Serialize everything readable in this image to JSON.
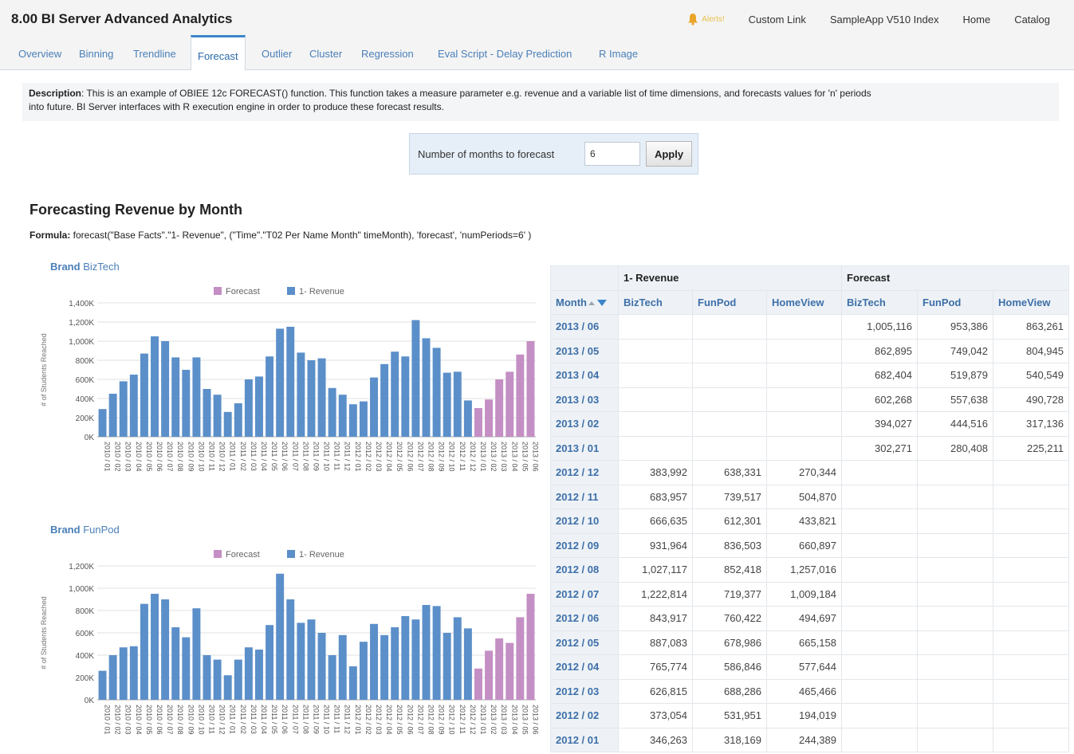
{
  "header": {
    "app_title": "8.00 BI Server Advanced Analytics",
    "alerts_label": "Alerts!",
    "links": [
      "Custom Link",
      "SampleApp V510 Index",
      "Home",
      "Catalog"
    ]
  },
  "tabs": [
    "Overview",
    "Binning",
    "Trendline",
    "Forecast",
    "Outlier",
    "Cluster",
    "Regression",
    "Eval Script - Delay Prediction",
    "R Image"
  ],
  "active_tab": "Forecast",
  "description": {
    "label": "Description",
    "text": ": This is an example of OBIEE 12c FORECAST() function. This function takes a measure parameter e.g. revenue and a variable list of time dimensions, and forecasts values for 'n' periods",
    "text_line2": "into future. BI Server interfaces with R execution engine in order to produce these forecast results."
  },
  "prompt": {
    "label": "Number of months to forecast",
    "value": "6",
    "apply_label": "Apply"
  },
  "section": {
    "title": "Forecasting Revenue by Month",
    "formula_label": "Formula:",
    "formula_text": " forecast(\"Base Facts\".\"1- Revenue\", (\"Time\".\"T02 Per Name Month\" timeMonth), 'forecast', 'numPeriods=6' )"
  },
  "colors": {
    "revenue": "#5b8fc9",
    "forecast": "#c48fc4",
    "accent": "#3c86c9"
  },
  "chart_data": [
    {
      "type": "bar",
      "brand_prefix": "Brand",
      "brand": "BizTech",
      "ylabel": "# of Students Reached",
      "legend": [
        "Forecast",
        "1- Revenue"
      ],
      "legend_position": "top",
      "ylim": [
        0,
        1400000
      ],
      "yticks": [
        "0K",
        "200K",
        "400K",
        "600K",
        "800K",
        "1,000K",
        "1,200K",
        "1,400K"
      ],
      "categories": [
        "2010 / 01",
        "2010 / 02",
        "2010 / 03",
        "2010 / 04",
        "2010 / 05",
        "2010 / 06",
        "2010 / 07",
        "2010 / 08",
        "2010 / 09",
        "2010 / 10",
        "2010 / 11",
        "2010 / 12",
        "2011 / 01",
        "2011 / 02",
        "2011 / 03",
        "2011 / 04",
        "2011 / 05",
        "2011 / 06",
        "2011 / 07",
        "2011 / 08",
        "2011 / 09",
        "2011 / 10",
        "2011 / 11",
        "2011 / 12",
        "2012 / 01",
        "2012 / 02",
        "2012 / 03",
        "2012 / 04",
        "2012 / 05",
        "2012 / 06",
        "2012 / 07",
        "2012 / 08",
        "2012 / 09",
        "2012 / 10",
        "2012 / 11",
        "2012 / 12",
        "2013 / 01",
        "2013 / 02",
        "2013 / 03",
        "2013 / 04",
        "2013 / 05",
        "2013 / 06"
      ],
      "series": [
        {
          "name": "1- Revenue",
          "values": [
            290000,
            450000,
            580000,
            650000,
            870000,
            1050000,
            1000000,
            830000,
            700000,
            830000,
            500000,
            440000,
            260000,
            350000,
            600000,
            630000,
            840000,
            1130000,
            1150000,
            880000,
            800000,
            820000,
            510000,
            440000,
            340000,
            370000,
            620000,
            760000,
            890000,
            840000,
            1220000,
            1030000,
            930000,
            670000,
            680000,
            380000,
            null,
            null,
            null,
            null,
            null,
            null
          ]
        },
        {
          "name": "Forecast",
          "values": [
            null,
            null,
            null,
            null,
            null,
            null,
            null,
            null,
            null,
            null,
            null,
            null,
            null,
            null,
            null,
            null,
            null,
            null,
            null,
            null,
            null,
            null,
            null,
            null,
            null,
            null,
            null,
            null,
            null,
            null,
            null,
            null,
            null,
            null,
            null,
            null,
            300000,
            390000,
            600000,
            680000,
            860000,
            1000000
          ]
        }
      ]
    },
    {
      "type": "bar",
      "brand_prefix": "Brand",
      "brand": "FunPod",
      "ylabel": "# of Students Reached",
      "legend": [
        "Forecast",
        "1- Revenue"
      ],
      "legend_position": "top",
      "ylim": [
        0,
        1200000
      ],
      "yticks": [
        "0K",
        "200K",
        "400K",
        "600K",
        "800K",
        "1,000K",
        "1,200K"
      ],
      "categories": [
        "2010 / 01",
        "2010 / 02",
        "2010 / 03",
        "2010 / 04",
        "2010 / 05",
        "2010 / 06",
        "2010 / 07",
        "2010 / 08",
        "2010 / 09",
        "2010 / 10",
        "2010 / 11",
        "2010 / 12",
        "2011 / 01",
        "2011 / 02",
        "2011 / 03",
        "2011 / 04",
        "2011 / 05",
        "2011 / 06",
        "2011 / 07",
        "2011 / 08",
        "2011 / 09",
        "2011 / 10",
        "2011 / 11",
        "2011 / 12",
        "2012 / 01",
        "2012 / 02",
        "2012 / 03",
        "2012 / 04",
        "2012 / 05",
        "2012 / 06",
        "2012 / 07",
        "2012 / 08",
        "2012 / 09",
        "2012 / 10",
        "2012 / 11",
        "2012 / 12",
        "2013 / 01",
        "2013 / 02",
        "2013 / 03",
        "2013 / 04",
        "2013 / 05",
        "2013 / 06"
      ],
      "series": [
        {
          "name": "1- Revenue",
          "values": [
            260000,
            400000,
            470000,
            480000,
            860000,
            950000,
            900000,
            650000,
            560000,
            820000,
            400000,
            360000,
            220000,
            360000,
            470000,
            450000,
            670000,
            1130000,
            900000,
            690000,
            720000,
            600000,
            400000,
            580000,
            300000,
            520000,
            680000,
            580000,
            650000,
            750000,
            720000,
            850000,
            840000,
            600000,
            740000,
            640000,
            null,
            null,
            null,
            null,
            null,
            null
          ]
        },
        {
          "name": "Forecast",
          "values": [
            null,
            null,
            null,
            null,
            null,
            null,
            null,
            null,
            null,
            null,
            null,
            null,
            null,
            null,
            null,
            null,
            null,
            null,
            null,
            null,
            null,
            null,
            null,
            null,
            null,
            null,
            null,
            null,
            null,
            null,
            null,
            null,
            null,
            null,
            null,
            null,
            280000,
            440000,
            550000,
            510000,
            740000,
            950000
          ]
        }
      ]
    }
  ],
  "table": {
    "group_headers": [
      "1- Revenue",
      "Forecast"
    ],
    "row_header_label": "Month",
    "columns": [
      "BizTech",
      "FunPod",
      "HomeView",
      "BizTech",
      "FunPod",
      "HomeView"
    ],
    "rows": [
      {
        "month": "2013 / 06",
        "values": [
          "",
          "",
          "",
          "1,005,116",
          "953,386",
          "863,261"
        ]
      },
      {
        "month": "2013 / 05",
        "values": [
          "",
          "",
          "",
          "862,895",
          "749,042",
          "804,945"
        ]
      },
      {
        "month": "2013 / 04",
        "values": [
          "",
          "",
          "",
          "682,404",
          "519,879",
          "540,549"
        ]
      },
      {
        "month": "2013 / 03",
        "values": [
          "",
          "",
          "",
          "602,268",
          "557,638",
          "490,728"
        ]
      },
      {
        "month": "2013 / 02",
        "values": [
          "",
          "",
          "",
          "394,027",
          "444,516",
          "317,136"
        ]
      },
      {
        "month": "2013 / 01",
        "values": [
          "",
          "",
          "",
          "302,271",
          "280,408",
          "225,211"
        ]
      },
      {
        "month": "2012 / 12",
        "values": [
          "383,992",
          "638,331",
          "270,344",
          "",
          "",
          ""
        ]
      },
      {
        "month": "2012 / 11",
        "values": [
          "683,957",
          "739,517",
          "504,870",
          "",
          "",
          ""
        ]
      },
      {
        "month": "2012 / 10",
        "values": [
          "666,635",
          "612,301",
          "433,821",
          "",
          "",
          ""
        ]
      },
      {
        "month": "2012 / 09",
        "values": [
          "931,964",
          "836,503",
          "660,897",
          "",
          "",
          ""
        ]
      },
      {
        "month": "2012 / 08",
        "values": [
          "1,027,117",
          "852,418",
          "1,257,016",
          "",
          "",
          ""
        ]
      },
      {
        "month": "2012 / 07",
        "values": [
          "1,222,814",
          "719,377",
          "1,009,184",
          "",
          "",
          ""
        ]
      },
      {
        "month": "2012 / 06",
        "values": [
          "843,917",
          "760,422",
          "494,697",
          "",
          "",
          ""
        ]
      },
      {
        "month": "2012 / 05",
        "values": [
          "887,083",
          "678,986",
          "665,158",
          "",
          "",
          ""
        ]
      },
      {
        "month": "2012 / 04",
        "values": [
          "765,774",
          "586,846",
          "577,644",
          "",
          "",
          ""
        ]
      },
      {
        "month": "2012 / 03",
        "values": [
          "626,815",
          "688,286",
          "465,466",
          "",
          "",
          ""
        ]
      },
      {
        "month": "2012 / 02",
        "values": [
          "373,054",
          "531,951",
          "194,019",
          "",
          "",
          ""
        ]
      },
      {
        "month": "2012 / 01",
        "values": [
          "346,263",
          "318,169",
          "244,389",
          "",
          "",
          ""
        ]
      }
    ]
  }
}
